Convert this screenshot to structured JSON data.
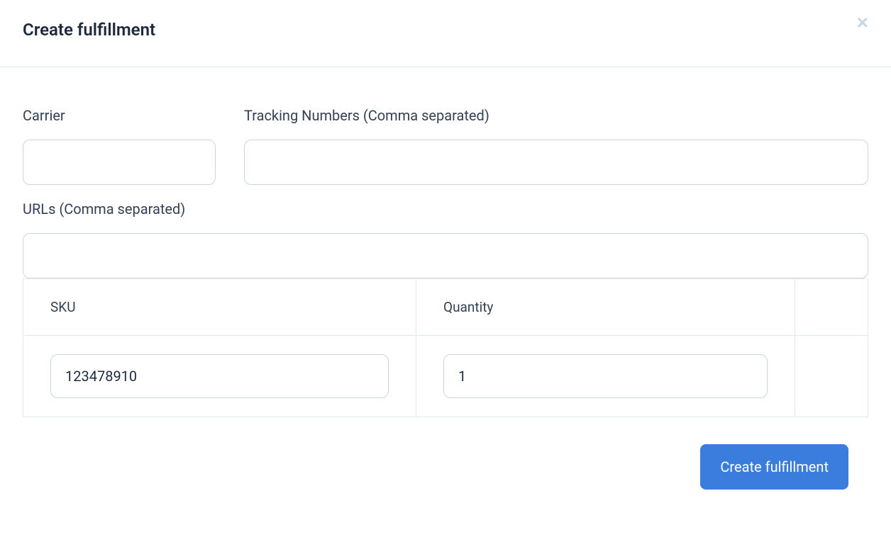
{
  "header": {
    "title": "Create fulfillment"
  },
  "form": {
    "carrier": {
      "label": "Carrier",
      "value": ""
    },
    "trackingNumbers": {
      "label": "Tracking Numbers (Comma separated)",
      "value": ""
    },
    "urls": {
      "label": "URLs (Comma separated)",
      "value": ""
    }
  },
  "table": {
    "headers": {
      "sku": "SKU",
      "quantity": "Quantity"
    },
    "rows": [
      {
        "sku": "123478910",
        "quantity": "1"
      }
    ]
  },
  "footer": {
    "submitLabel": "Create fulfillment"
  }
}
